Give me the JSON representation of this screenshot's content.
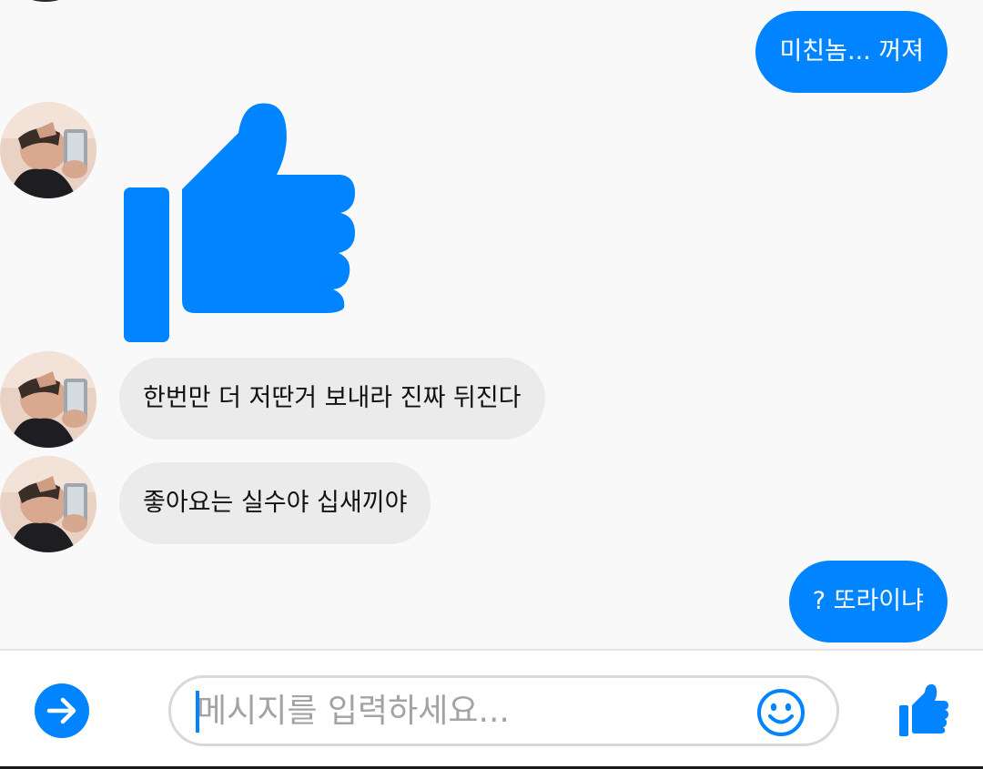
{
  "messages": [
    {
      "direction": "outgoing",
      "text": "미친놈... 꺼져"
    },
    {
      "direction": "incoming",
      "type": "like-sticker"
    },
    {
      "direction": "incoming",
      "text": "한번만 더 저딴거 보내라 진짜 뒤진다"
    },
    {
      "direction": "incoming",
      "text": "좋아요는 실수야 십새끼야"
    },
    {
      "direction": "outgoing",
      "text": "? 또라이냐"
    }
  ],
  "composer": {
    "placeholder": "메시지를 입력하세요...",
    "value": ""
  },
  "icons": {
    "send": "arrow-right-icon",
    "emoji": "smiley-icon",
    "like": "thumbs-up-icon",
    "sticker": "thumbs-up-icon"
  },
  "colors": {
    "accent": "#0084ff",
    "incoming_bubble": "#ebebeb",
    "background": "#f9f9fa"
  }
}
